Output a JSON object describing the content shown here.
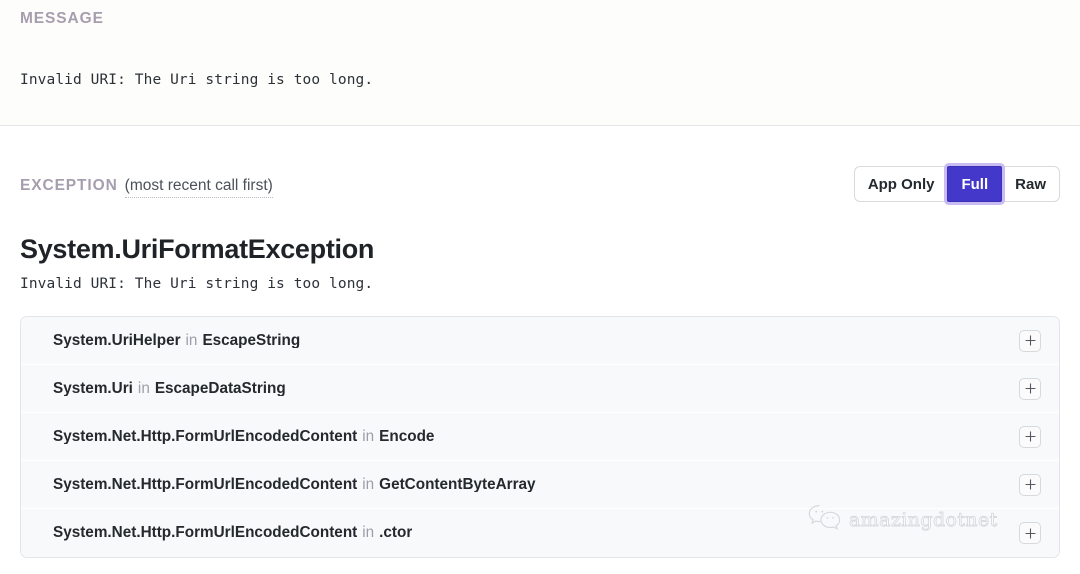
{
  "message_section": {
    "eyebrow": "MESSAGE",
    "body": "Invalid URI: The Uri string is too long."
  },
  "exception_section": {
    "eyebrow": "EXCEPTION",
    "hint": "(most recent call first)",
    "view_modes": [
      {
        "label": "App Only",
        "selected": false
      },
      {
        "label": "Full",
        "selected": true
      },
      {
        "label": "Raw",
        "selected": false
      }
    ],
    "exception_type": "System.UriFormatException",
    "exception_message": "Invalid URI: The Uri string is too long.",
    "frames": [
      {
        "class": "System.UriHelper",
        "in": "in",
        "method": "EscapeString",
        "expand_icon": "plus-icon"
      },
      {
        "class": "System.Uri",
        "in": "in",
        "method": "EscapeDataString",
        "expand_icon": "plus-icon"
      },
      {
        "class": "System.Net.Http.FormUrlEncodedContent",
        "in": "in",
        "method": "Encode",
        "expand_icon": "plus-icon"
      },
      {
        "class": "System.Net.Http.FormUrlEncodedContent",
        "in": "in",
        "method": "GetContentByteArray",
        "expand_icon": "plus-icon"
      },
      {
        "class": "System.Net.Http.FormUrlEncodedContent",
        "in": "in",
        "method": ".ctor",
        "expand_icon": "plus-icon"
      }
    ]
  },
  "watermark": {
    "icon": "wechat-icon",
    "text": "amazingdotnet"
  },
  "colors": {
    "eyebrow": "#a69eae",
    "accent_active": "#4338ca",
    "focus_ring": "#c9bcf2",
    "row_bg": "#f8f9fb",
    "text_primary": "#24292e",
    "text_muted": "#9aa0a8"
  }
}
